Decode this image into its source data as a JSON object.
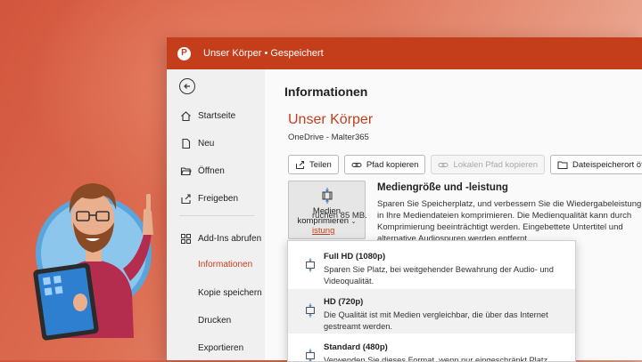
{
  "titlebar": {
    "title": "Unser Körper • Gespeichert",
    "logo_letter": "P",
    "accent": "#c43e1c"
  },
  "sidebar": {
    "items": [
      {
        "label": "Startseite",
        "icon": "home-icon"
      },
      {
        "label": "Neu",
        "icon": "new-file-icon"
      },
      {
        "label": "Öffnen",
        "icon": "folder-open-icon"
      },
      {
        "label": "Freigeben",
        "icon": "share-icon"
      },
      {
        "label": "Add-Ins abrufen",
        "icon": "add-ins-icon"
      },
      {
        "label": "Informationen",
        "active": true
      },
      {
        "label": "Kopie speichern"
      },
      {
        "label": "Drucken"
      },
      {
        "label": "Exportieren"
      }
    ]
  },
  "main": {
    "page_title": "Informationen",
    "doc_name": "Unser Körper",
    "doc_location": "OneDrive - Malter365",
    "actions": {
      "share": "Teilen",
      "copy_path": "Pfad kopieren",
      "copy_local_path": "Lokalen Pfad kopieren",
      "open_location": "Dateispeicherort öff"
    },
    "media_button": {
      "line1": "Medien",
      "line2": "komprimieren"
    },
    "media_section": {
      "title": "Mediengröße und -leistung",
      "description": "Sparen Sie Speicherplatz, und verbessern Sie die Wiedergabeleistung, in Ihre Mediendateien komprimieren. Die Medienqualität kann durch Komprimierung beeinträchtigt werden. Eingebettete Untertitel und alternative Audiospuren werden entfernt.",
      "extra_text": "ruchen 85 MB.",
      "extra_link": "istung"
    }
  },
  "dropdown": {
    "options": [
      {
        "title": "Full HD (1080p)",
        "desc": "Sparen Sie Platz, bei weitgehender Bewahrung der Audio- und Videoqualität."
      },
      {
        "title": "HD (720p)",
        "desc": "Die Qualität ist mit Medien vergleichbar, die über das Internet gestreamt werden."
      },
      {
        "title": "Standard (480p)",
        "desc": "Verwenden Sie dieses Format, wenn nur eingeschränkt Platz"
      }
    ]
  }
}
